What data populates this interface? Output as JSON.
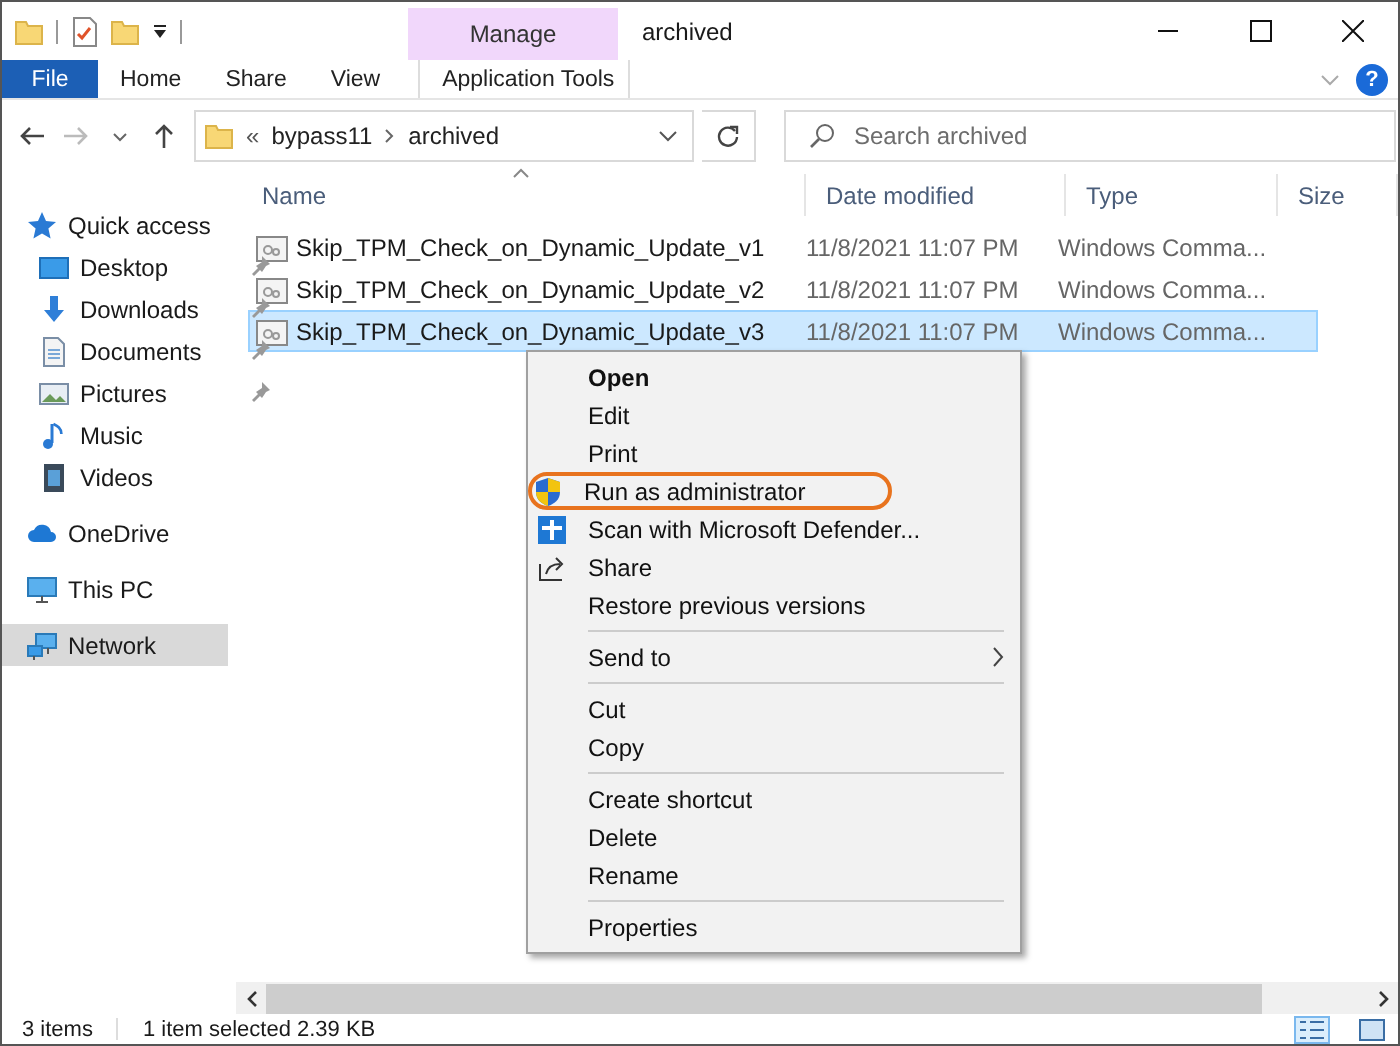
{
  "window": {
    "title": "archived",
    "context_tab": "Manage"
  },
  "ribbon": {
    "tabs": [
      {
        "label": "File",
        "kind": "file"
      },
      {
        "label": "Home",
        "kind": "normal"
      },
      {
        "label": "Share",
        "kind": "normal"
      },
      {
        "label": "View",
        "kind": "normal"
      },
      {
        "label": "Application Tools",
        "kind": "contextual"
      }
    ],
    "help": "?"
  },
  "address": {
    "overflow": "«",
    "path": [
      "bypass11",
      "archived"
    ]
  },
  "search": {
    "placeholder": "Search archived"
  },
  "sidebar": {
    "items": [
      {
        "label": "Quick access",
        "kind": "star",
        "pinned": false,
        "selected": false
      },
      {
        "label": "Desktop",
        "kind": "desktop",
        "pinned": true,
        "selected": false
      },
      {
        "label": "Downloads",
        "kind": "download",
        "pinned": true,
        "selected": false
      },
      {
        "label": "Documents",
        "kind": "document",
        "pinned": true,
        "selected": false
      },
      {
        "label": "Pictures",
        "kind": "picture",
        "pinned": true,
        "selected": false
      },
      {
        "label": "Music",
        "kind": "music",
        "pinned": false,
        "selected": false
      },
      {
        "label": "Videos",
        "kind": "video",
        "pinned": false,
        "selected": false
      },
      {
        "label": "OneDrive",
        "kind": "cloud",
        "pinned": false,
        "selected": false
      },
      {
        "label": "This PC",
        "kind": "pc",
        "pinned": false,
        "selected": false
      },
      {
        "label": "Network",
        "kind": "network",
        "pinned": false,
        "selected": true
      }
    ]
  },
  "table": {
    "columns": [
      "Name",
      "Date modified",
      "Type",
      "Size"
    ],
    "rows": [
      {
        "name": "Skip_TPM_Check_on_Dynamic_Update_v1",
        "date": "11/8/2021 11:07 PM",
        "type": "Windows Comma...",
        "selected": false
      },
      {
        "name": "Skip_TPM_Check_on_Dynamic_Update_v2",
        "date": "11/8/2021 11:07 PM",
        "type": "Windows Comma...",
        "selected": false
      },
      {
        "name": "Skip_TPM_Check_on_Dynamic_Update_v3",
        "date": "11/8/2021 11:07 PM",
        "type": "Windows Comma...",
        "selected": true
      }
    ]
  },
  "context_menu": {
    "items": [
      {
        "kind": "item",
        "label": "Open",
        "default": true
      },
      {
        "kind": "item",
        "label": "Edit"
      },
      {
        "kind": "item",
        "label": "Print"
      },
      {
        "kind": "shield",
        "label": "Run as administrator",
        "highlighted": true
      },
      {
        "kind": "defender",
        "label": "Scan with Microsoft Defender..."
      },
      {
        "kind": "share",
        "label": "Share"
      },
      {
        "kind": "item",
        "label": "Restore previous versions"
      },
      {
        "kind": "separator"
      },
      {
        "kind": "item",
        "label": "Send to",
        "submenu": true
      },
      {
        "kind": "separator"
      },
      {
        "kind": "item",
        "label": "Cut"
      },
      {
        "kind": "item",
        "label": "Copy"
      },
      {
        "kind": "separator"
      },
      {
        "kind": "item",
        "label": "Create shortcut"
      },
      {
        "kind": "item",
        "label": "Delete"
      },
      {
        "kind": "item",
        "label": "Rename"
      },
      {
        "kind": "separator"
      },
      {
        "kind": "item",
        "label": "Properties"
      }
    ]
  },
  "status_bar": {
    "items": [
      "3 items",
      "1 item selected  2.39 KB"
    ],
    "views": [
      {
        "kind": "details",
        "selected": true
      },
      {
        "kind": "large",
        "selected": false
      }
    ]
  }
}
